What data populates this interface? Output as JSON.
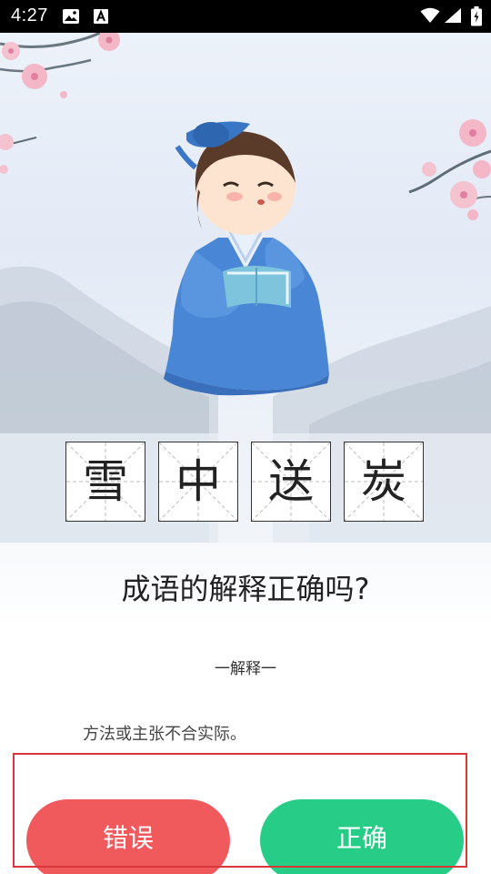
{
  "status_bar": {
    "time": "4:27",
    "icons": [
      "image-icon",
      "font-a-icon",
      "wifi-icon",
      "signal-icon",
      "battery-icon"
    ]
  },
  "idiom": {
    "characters": [
      "雪",
      "中",
      "送",
      "炭"
    ]
  },
  "quiz": {
    "question": "成语的解释正确吗?",
    "explanation_label": "一解释一",
    "explanation_text": "方法或主张不合实际。"
  },
  "buttons": {
    "wrong_label": "错误",
    "right_label": "正确",
    "wrong_color": "#f15a5c",
    "right_color": "#27cd86"
  },
  "colors": {
    "highlight_border": "#d9373a",
    "robe_blue": "#4a86d6"
  }
}
